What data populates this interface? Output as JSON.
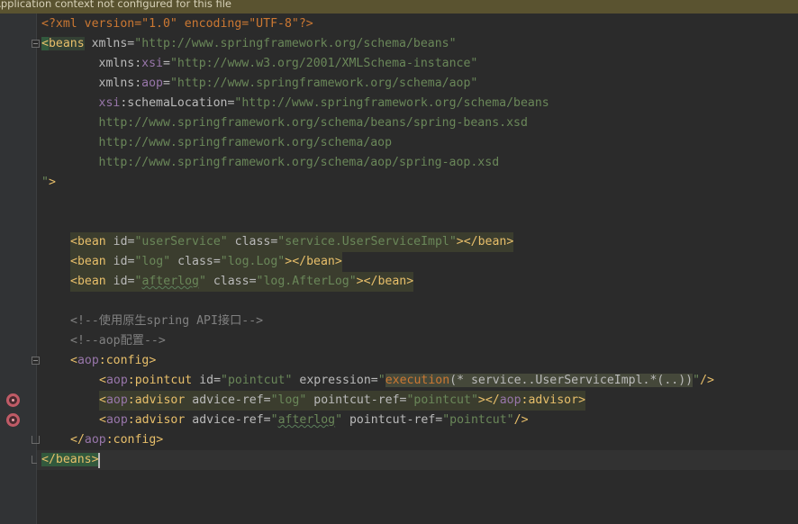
{
  "banner": {
    "text": "Application context not configured for this file"
  },
  "editor": {
    "line1": {
      "decl": "<?xml version=\"1.0\" encoding=\"UTF-8\"?>"
    },
    "line2": {
      "open": "<",
      "tag": "beans",
      "attr": " xmlns",
      "eq": "=",
      "val": "\"http://www.springframework.org/schema/beans\""
    },
    "line3": {
      "pre": "        xmlns",
      "colon": ":",
      "ns": "xsi",
      "eq": "=",
      "val": "\"http://www.w3.org/2001/XMLSchema-instance\""
    },
    "line4": {
      "pre": "        xmlns",
      "colon": ":",
      "ns": "aop",
      "eq": "=",
      "val": "\"http://www.springframework.org/schema/aop\""
    },
    "line5": {
      "pre": "        ",
      "ns": "xsi",
      "attr": ":schemaLocation",
      "eq": "=",
      "val": "\"http://www.springframework.org/schema/beans"
    },
    "line6": {
      "val": "        http://www.springframework.org/schema/beans/spring-beans.xsd"
    },
    "line7": {
      "val": "        http://www.springframework.org/schema/aop"
    },
    "line8": {
      "val": "        http://www.springframework.org/schema/aop/spring-aop.xsd"
    },
    "line9": {
      "val": "\"",
      "close": ">"
    },
    "bean1": {
      "open": "<bean",
      "a1": " id",
      "eq1": "=",
      "v1": "\"userService\"",
      "a2": " class",
      "eq2": "=",
      "v2": "\"service.UserServiceImpl\"",
      "close": "></bean>"
    },
    "bean2": {
      "open": "<bean",
      "a1": " id",
      "eq1": "=",
      "v1": "\"log\"",
      "a2": " class",
      "eq2": "=",
      "v2": "\"log.Log\"",
      "close": "></bean>"
    },
    "bean3": {
      "open": "<bean",
      "a1": " id",
      "eq1": "=",
      "q1": "\"",
      "v1": "afterlog",
      "q2": "\"",
      "a2": " class",
      "eq2": "=",
      "v2": "\"log.AfterLog\"",
      "close": "></bean>"
    },
    "comment1": "<!--使用原生spring API接口-->",
    "comment2": "<!--aop配置-->",
    "config_open": {
      "lt": "<",
      "ns": "aop",
      "tag": ":config",
      "gt": ">"
    },
    "pointcut": {
      "lt": "<",
      "ns": "aop",
      "tag": ":pointcut",
      "a1": " id",
      "eq1": "=",
      "v1": "\"pointcut\"",
      "a2": " expression",
      "eq2": "=",
      "q": "\"",
      "fn": "execution",
      "expr": "(* service..UserServiceImpl.*(..))",
      "q2": "\"",
      "close": "/>"
    },
    "advisor1": {
      "lt": "<",
      "ns": "aop",
      "tag": ":advisor",
      "a1": " advice-ref",
      "eq1": "=",
      "v1": "\"log\"",
      "a2": " pointcut-ref",
      "eq2": "=",
      "v2": "\"pointcut\"",
      "close1": "></",
      "ns2": "aop",
      "tag2": ":advisor",
      "gt": ">"
    },
    "advisor2": {
      "lt": "<",
      "ns": "aop",
      "tag": ":advisor",
      "a1": " advice-ref",
      "eq1": "=",
      "q1": "\"",
      "v1": "afterlog",
      "q2": "\"",
      "a2": " pointcut-ref",
      "eq2": "=",
      "v2": "\"pointcut\"",
      "close": "/>"
    },
    "config_close": {
      "lt": "</",
      "ns": "aop",
      "tag": ":config",
      "gt": ">"
    },
    "beans_close": {
      "lt": "</",
      "tag": "beans",
      "gt": ">"
    }
  },
  "gutter": {
    "icons": [
      "advice-icon",
      "advice-icon"
    ]
  }
}
